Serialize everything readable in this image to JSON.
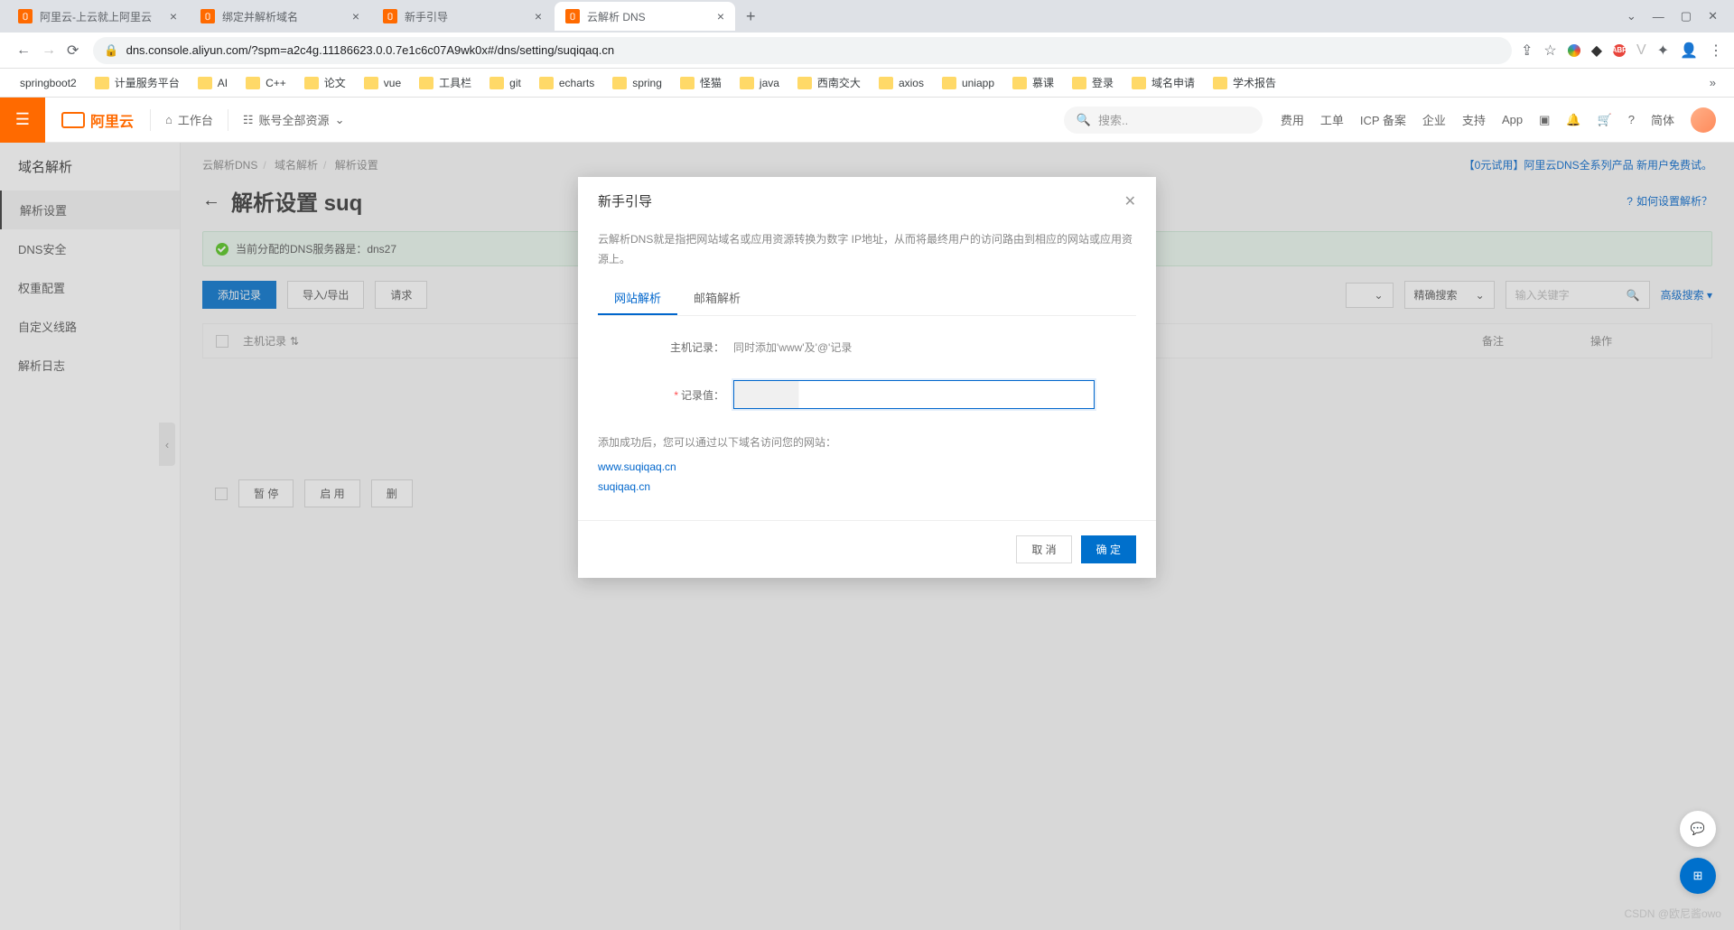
{
  "browser": {
    "tabs": [
      {
        "title": "阿里云-上云就上阿里云"
      },
      {
        "title": "绑定并解析域名"
      },
      {
        "title": "新手引导"
      },
      {
        "title": "云解析 DNS"
      }
    ],
    "url": "dns.console.aliyun.com/?spm=a2c4g.11186623.0.0.7e1c6c07A9wk0x#/dns/setting/suqiqaq.cn",
    "bookmarks": [
      "springboot2",
      "计量服务平台",
      "AI",
      "C++",
      "论文",
      "vue",
      "工具栏",
      "git",
      "echarts",
      "spring",
      "怪猫",
      "java",
      "西南交大",
      "axios",
      "uniapp",
      "慕课",
      "登录",
      "域名申请",
      "学术报告"
    ]
  },
  "header": {
    "logo": "阿里云",
    "workbench": "工作台",
    "account": "账号全部资源",
    "search_placeholder": "搜索..",
    "right": [
      "费用",
      "工单",
      "ICP 备案",
      "企业",
      "支持",
      "App"
    ],
    "lang": "简体"
  },
  "sidebar": {
    "title": "域名解析",
    "items": [
      "解析设置",
      "DNS安全",
      "权重配置",
      "自定义线路",
      "解析日志"
    ]
  },
  "breadcrumbs": [
    "云解析DNS",
    "域名解析",
    "解析设置"
  ],
  "promo": "【0元试用】阿里云DNS全系列产品 新用户免费试。",
  "page_title": "解析设置 suq",
  "help_link": "如何设置解析？",
  "banner": "当前分配的DNS服务器是：dns27",
  "toolbar": {
    "add": "添加记录",
    "import": "导入/导出",
    "request": "请求",
    "precise": "精确搜索",
    "input_ph": "输入关键字",
    "adv": "高级搜索"
  },
  "table": {
    "host": "主机记录",
    "remark": "备注",
    "action": "操作"
  },
  "pagination": {
    "pause": "暂 停",
    "enable": "启 用",
    "del": "删"
  },
  "modal": {
    "title": "新手引导",
    "desc": "云解析DNS就是指把网站域名或应用资源转换为数字 IP地址，从而将最终用户的访问路由到相应的网站或应用资源上。",
    "tab1": "网站解析",
    "tab2": "邮箱解析",
    "host_label": "主机记录：",
    "host_value": "同时添加'www'及'@'记录",
    "value_label": "记录值：",
    "success": "添加成功后，您可以通过以下域名访问您的网站：",
    "link1": "www.suqiqaq.cn",
    "link2": "suqiqaq.cn",
    "cancel": "取 消",
    "confirm": "确 定"
  },
  "watermark": "CSDN @欧尼酱owo"
}
